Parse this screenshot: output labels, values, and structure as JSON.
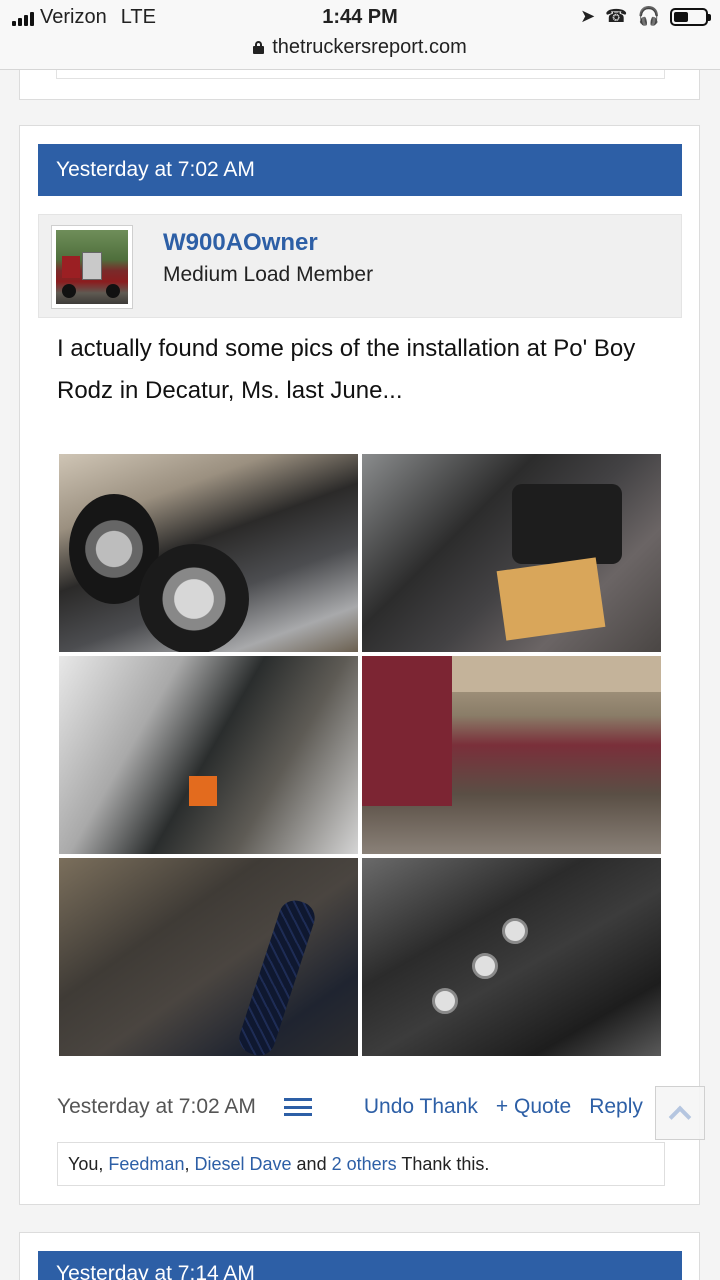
{
  "status_bar": {
    "carrier": "Verizon",
    "network": "LTE",
    "time": "1:44 PM",
    "battery_level": 0.45,
    "url": "thetruckersreport.com"
  },
  "post": {
    "date": "Yesterday at 7:02 AM",
    "author": {
      "name": "W900AOwner",
      "title": "Medium Load Member"
    },
    "message": "I actually found some pics of the installation at Po' Boy Rodz in Decatur, Ms. last June...",
    "footer": {
      "date": "Yesterday at 7:02 AM",
      "undo_thank": "Undo Thank",
      "quote": "+ Quote",
      "reply": "Reply"
    },
    "likes": {
      "you": "You,",
      "user1": "Feedman",
      "sep": ",",
      "user2": "Diesel Dave",
      "and": "and",
      "others": "2 others",
      "suffix": "Thank this."
    }
  },
  "next_post": {
    "date": "Yesterday at 7:14 AM"
  }
}
